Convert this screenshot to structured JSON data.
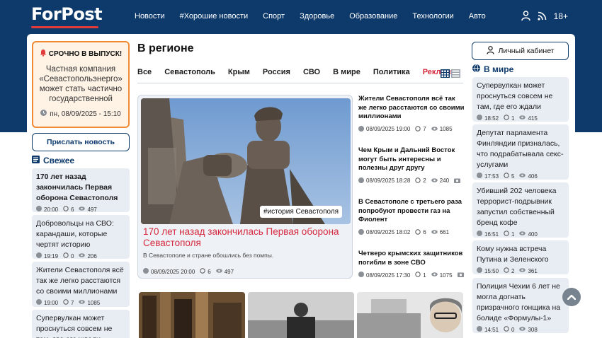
{
  "header": {
    "logo": "ForPost",
    "nav": [
      "Новости",
      "#Хорошие новости",
      "Спорт",
      "Здоровье",
      "Образование",
      "Технологии",
      "Авто"
    ],
    "age": "18+"
  },
  "urgent": {
    "title": "СРОЧНО В ВЫПУСК!",
    "text": "Частная компания «Севастопольэнерго» может стать частично государственной",
    "date": "пн, 08/09/2025 - 15:10"
  },
  "send_news_label": "Прислать новость",
  "fresh": {
    "title": "Свежее",
    "items": [
      {
        "title": "170 лет назад закончилась Первая оборона Севастополя",
        "time": "20:00",
        "comments": "6",
        "views": "497"
      },
      {
        "title": "Добровольцы на СВО: карандаши, которые чертят историю",
        "time": "19:19",
        "comments": "0",
        "views": "206"
      },
      {
        "title": "Жители Севастополя всё так же легко расстаются со своими миллионами",
        "time": "19:00",
        "comments": "7",
        "views": "1085"
      },
      {
        "title": "Супервулкан может проснуться совсем не там, где его ждали",
        "time": "",
        "comments": "",
        "views": ""
      }
    ]
  },
  "region": {
    "title": "В регионе",
    "tabs": [
      "Все",
      "Севастополь",
      "Крым",
      "Россия",
      "СВО",
      "В мире",
      "Политика",
      "Реклама"
    ],
    "feature": {
      "tag": "#история Севастополя",
      "title": "170 лет назад закончилась Первая оборона Севастополя",
      "lead": "В Севастополе и стране обошлись без помпы.",
      "date": "08/09/2025 20:00",
      "comments": "6",
      "views": "497"
    },
    "side": [
      {
        "title": "Жители Севастополя всё так же легко расстаются со своими миллионами",
        "date": "08/09/2025 19:00",
        "comments": "7",
        "views": "1085"
      },
      {
        "title": "Чем Крым и Дальний Восток могут быть интересны и полезны друг другу",
        "date": "08/09/2025 18:28",
        "comments": "2",
        "views": "240"
      },
      {
        "title": "В Севастополе с третьего раза попробуют провести газ на Фиолент",
        "date": "08/09/2025 18:02",
        "comments": "6",
        "views": "661"
      },
      {
        "title": "Четверо крымских защитников погибли в зоне СВО",
        "date": "08/09/2025 17:30",
        "comments": "1",
        "views": "1075"
      }
    ]
  },
  "right": {
    "cabinet": "Личный кабинет",
    "world_title": "В мире",
    "items": [
      {
        "title": "Супервулкан может проснуться совсем не там, где его ждали",
        "time": "18:52",
        "comments": "1",
        "views": "415"
      },
      {
        "title": "Депутат парламента Финляндии призналась, что подрабатывала секс-услугами",
        "time": "17:53",
        "comments": "5",
        "views": "406"
      },
      {
        "title": "Убивший 202 человека террорист-подрывник запустил собственный бренд кофе",
        "time": "16:51",
        "comments": "1",
        "views": "400"
      },
      {
        "title": "Кому нужна встреча Путина и Зеленского",
        "time": "15:50",
        "comments": "2",
        "views": "361"
      },
      {
        "title": "Полиция Чехии 6 лет не могла догнать призрачного гонщика на болиде «Формулы-1»",
        "time": "14:51",
        "comments": "0",
        "views": "308"
      }
    ]
  },
  "colors": {
    "brand": "#0e3a6b",
    "accent": "#d6293e",
    "urgent": "#f08a33"
  }
}
